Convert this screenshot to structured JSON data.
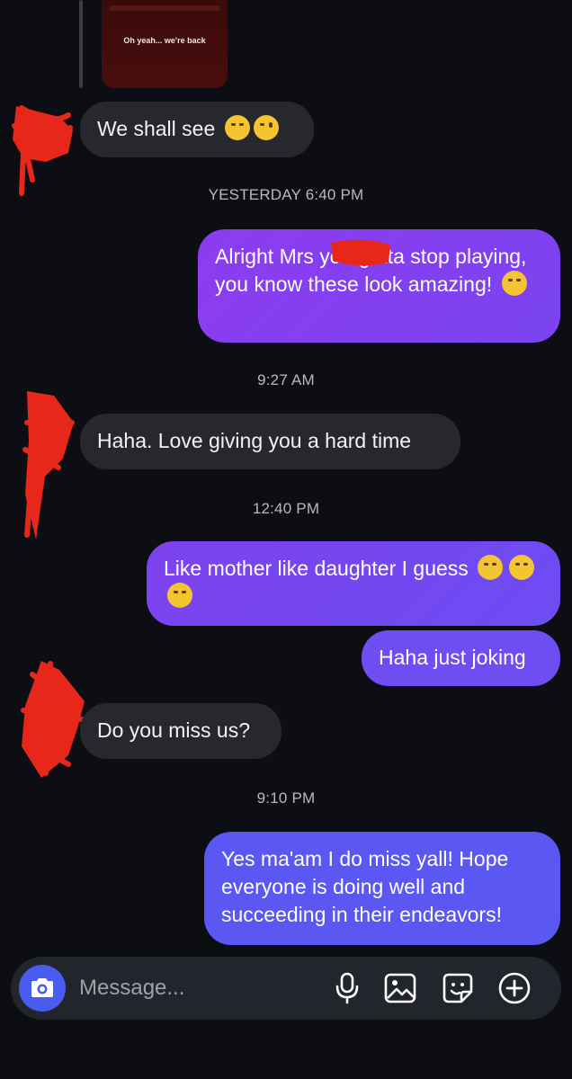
{
  "story_reply": {
    "caption": "Oh yeah... we're back"
  },
  "messages": [
    {
      "text": "We shall see"
    },
    {
      "text": "Alright Mrs you gotta stop playing, you know these look amazing!"
    },
    {
      "text": "Haha. Love giving you a hard time"
    },
    {
      "text": "Like mother like daughter I guess"
    },
    {
      "text": "Haha just joking"
    },
    {
      "text": "Do you miss us?"
    },
    {
      "text": "Yes ma'am I do miss yall! Hope everyone is doing well and succeeding in their endeavors!"
    }
  ],
  "timestamps": [
    "YESTERDAY 6:40 PM",
    "9:27 AM",
    "12:40 PM",
    "9:10 PM"
  ],
  "composer": {
    "placeholder": "Message..."
  },
  "icons": [
    "camera-icon",
    "microphone-icon",
    "gallery-icon",
    "sticker-icon",
    "add-icon"
  ],
  "colors": {
    "background": "#0c0e13",
    "incoming": "#26282e",
    "outgoing_purple": "#8a3ff0",
    "outgoing_blue": "#5a5af2",
    "camera": "#4a5cf0"
  }
}
